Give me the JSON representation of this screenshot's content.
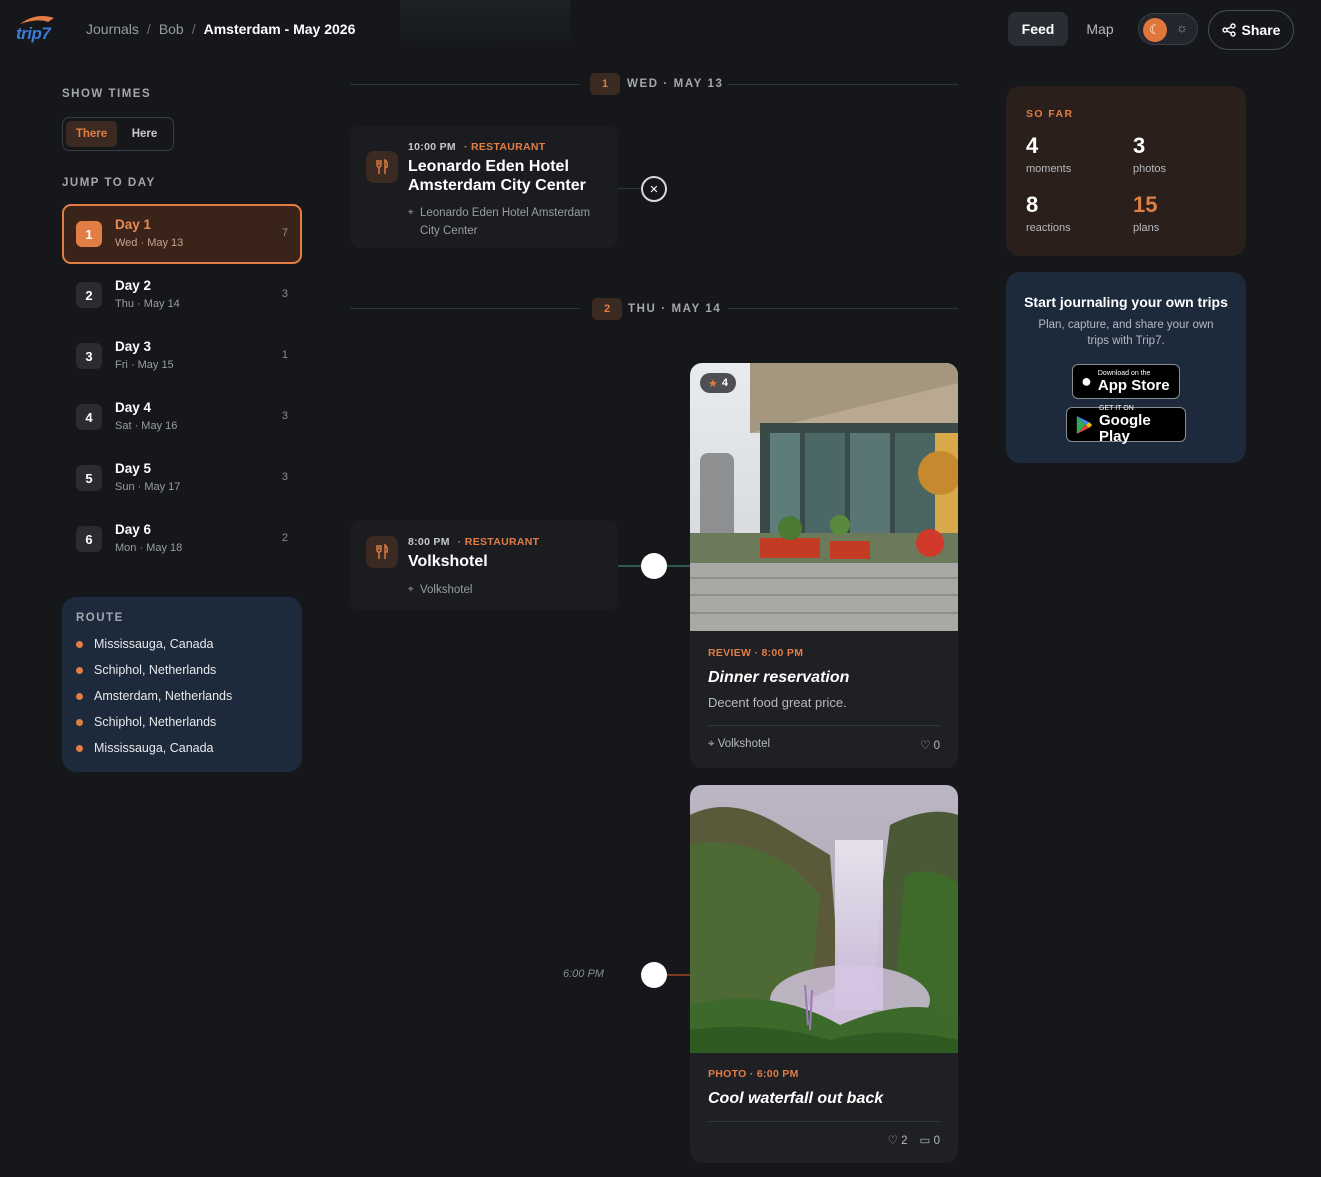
{
  "header": {
    "logo_text": "trip7",
    "breadcrumb": [
      "Journals",
      "Bob",
      "Amsterdam - May 2026"
    ],
    "feed_label": "Feed",
    "map_label": "Map",
    "share_label": "Share"
  },
  "sidebar": {
    "show_times_label": "SHOW TIMES",
    "time_options": [
      "There",
      "Here"
    ],
    "selected_time_option": "There",
    "jump_label": "JUMP TO DAY",
    "days": [
      {
        "num": "1",
        "title": "Day 1",
        "sub": "Wed · May 13",
        "count": "7",
        "active": true
      },
      {
        "num": "2",
        "title": "Day 2",
        "sub": "Thu · May 14",
        "count": "3"
      },
      {
        "num": "3",
        "title": "Day 3",
        "sub": "Fri · May 15",
        "count": "1"
      },
      {
        "num": "4",
        "title": "Day 4",
        "sub": "Sat · May 16",
        "count": "3"
      },
      {
        "num": "5",
        "title": "Day 5",
        "sub": "Sun · May 17",
        "count": "3"
      },
      {
        "num": "6",
        "title": "Day 6",
        "sub": "Mon · May 18",
        "count": "2"
      }
    ],
    "route_label": "ROUTE",
    "route": [
      "Mississauga, Canada",
      "Schiphol, Netherlands",
      "Amsterdam, Netherlands",
      "Schiphol, Netherlands",
      "Mississauga, Canada"
    ]
  },
  "timeline": {
    "day1": {
      "badge": "1",
      "label": "WED · MAY 13"
    },
    "day2": {
      "badge": "2",
      "label": "THU · MAY 14"
    },
    "moment1": {
      "time": "10:00 PM",
      "category": "· RESTAURANT",
      "title": "Leonardo Eden Hotel Amsterdam City Center",
      "location": "Leonardo Eden Hotel Amsterdam City Center"
    },
    "moment2": {
      "time": "8:00 PM",
      "category": "· RESTAURANT",
      "title": "Volkshotel",
      "location": "Volkshotel"
    },
    "review": {
      "rating": "4",
      "meta": "REVIEW · 8:00 PM",
      "title": "Dinner reservation",
      "desc": "Decent food great price.",
      "location": "Volkshotel",
      "likes": "0"
    },
    "photo": {
      "meta": "PHOTO · 6:00 PM",
      "title": "Cool waterfall out back",
      "likes": "2",
      "comments": "0",
      "time_label": "6:00 PM"
    }
  },
  "stats": {
    "label": "SO FAR",
    "moments_num": "4",
    "moments_lbl": "moments",
    "photos_num": "3",
    "photos_lbl": "photos",
    "reactions_num": "8",
    "reactions_lbl": "reactions",
    "plans_num": "15",
    "plans_lbl": "plans"
  },
  "promo": {
    "title": "Start journaling your own trips",
    "sub": "Plan, capture, and share your own trips with Trip7.",
    "appstore_small": "Download on the",
    "appstore_big": "App Store",
    "gplay_small": "GET IT ON",
    "gplay_big": "Google Play"
  },
  "colors": {
    "accent": "#e27d45",
    "background": "#15171b",
    "card_blue": "#1c2a3b",
    "card_brown": "#2a1f1a"
  }
}
